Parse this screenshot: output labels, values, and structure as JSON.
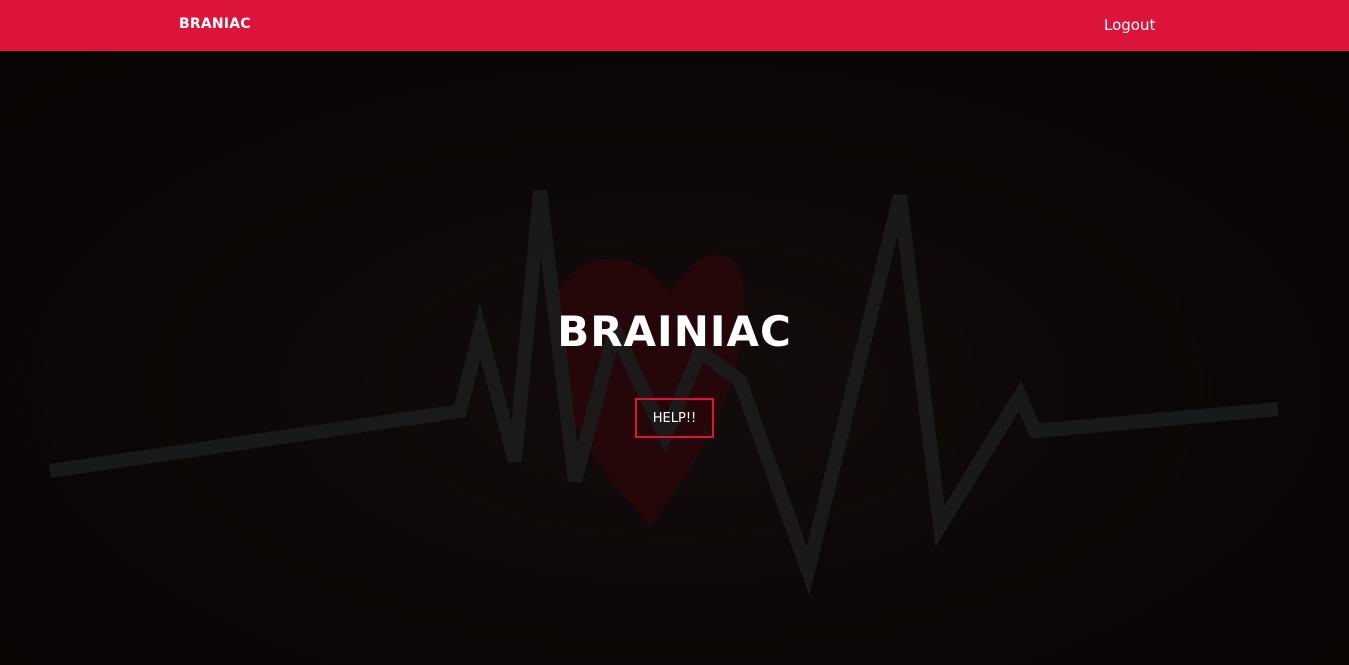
{
  "navbar": {
    "brand": "BRANIAC",
    "logout_label": "Logout",
    "background_color": "#dc143c"
  },
  "hero": {
    "title": "BRAINIAC",
    "help_button_label": "HELP!!",
    "background_image": "heartbeat-line-with-heart",
    "accent_color": "#dc143c"
  }
}
